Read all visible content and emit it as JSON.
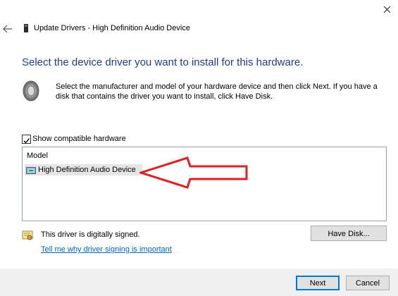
{
  "window": {
    "title": "Update Drivers - High Definition Audio Device",
    "close_icon": "close-icon",
    "back_icon": "back-arrow-icon"
  },
  "heading": "Select the device driver you want to install for this hardware.",
  "description": "Select the manufacturer and model of your hardware device and then click Next. If you have a disk that contains the driver you want to install, click Have Disk.",
  "show_compatible": {
    "label": "Show compatible hardware",
    "checked": true
  },
  "model_list": {
    "column_header": "Model",
    "items": [
      {
        "label": "High Definition Audio Device",
        "selected": true,
        "icon": "device-driver-icon"
      }
    ]
  },
  "annotation": {
    "icon": "red-arrow-annotation",
    "color": "#e02020"
  },
  "signing": {
    "status": "This driver is digitally signed.",
    "link": "Tell me why driver signing is important",
    "icon": "certificate-icon"
  },
  "buttons": {
    "have_disk": "Have Disk...",
    "next": "Next",
    "cancel": "Cancel"
  },
  "colors": {
    "heading": "#1e3e8c",
    "link": "#0066cc",
    "accent": "#0078d7"
  }
}
